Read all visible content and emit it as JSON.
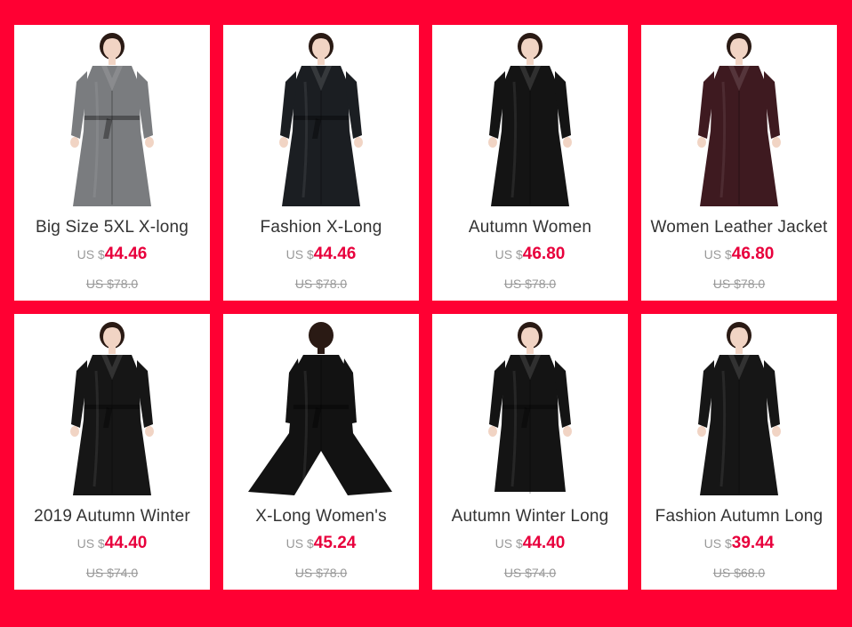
{
  "products": [
    {
      "title": "Big Size 5XL X-long",
      "currency": "US $",
      "price": "44.46",
      "old_price": "US $78.0",
      "coat_color": "#7a7c7f",
      "style": "belted"
    },
    {
      "title": "Fashion X-Long",
      "currency": "US $",
      "price": "44.46",
      "old_price": "US $78.0",
      "coat_color": "#1b1e22",
      "style": "belted"
    },
    {
      "title": "Autumn Women",
      "currency": "US $",
      "price": "46.80",
      "old_price": "US $78.0",
      "coat_color": "#141414",
      "style": "plain"
    },
    {
      "title": "Women Leather Jacket",
      "currency": "US $",
      "price": "46.80",
      "old_price": "US $78.0",
      "coat_color": "#3e1a20",
      "style": "plain"
    },
    {
      "title": "2019 Autumn Winter",
      "currency": "US $",
      "price": "44.40",
      "old_price": "US $74.0",
      "coat_color": "#161616",
      "style": "belted"
    },
    {
      "title": "X-Long Women's",
      "currency": "US $",
      "price": "45.24",
      "old_price": "US $78.0",
      "coat_color": "#121212",
      "style": "back"
    },
    {
      "title": "Autumn Winter Long",
      "currency": "US $",
      "price": "44.40",
      "old_price": "US $74.0",
      "coat_color": "#141414",
      "style": "belted-short"
    },
    {
      "title": "Fashion Autumn Long",
      "currency": "US $",
      "price": "39.44",
      "old_price": "US $68.0",
      "coat_color": "#161616",
      "style": "plain"
    }
  ]
}
